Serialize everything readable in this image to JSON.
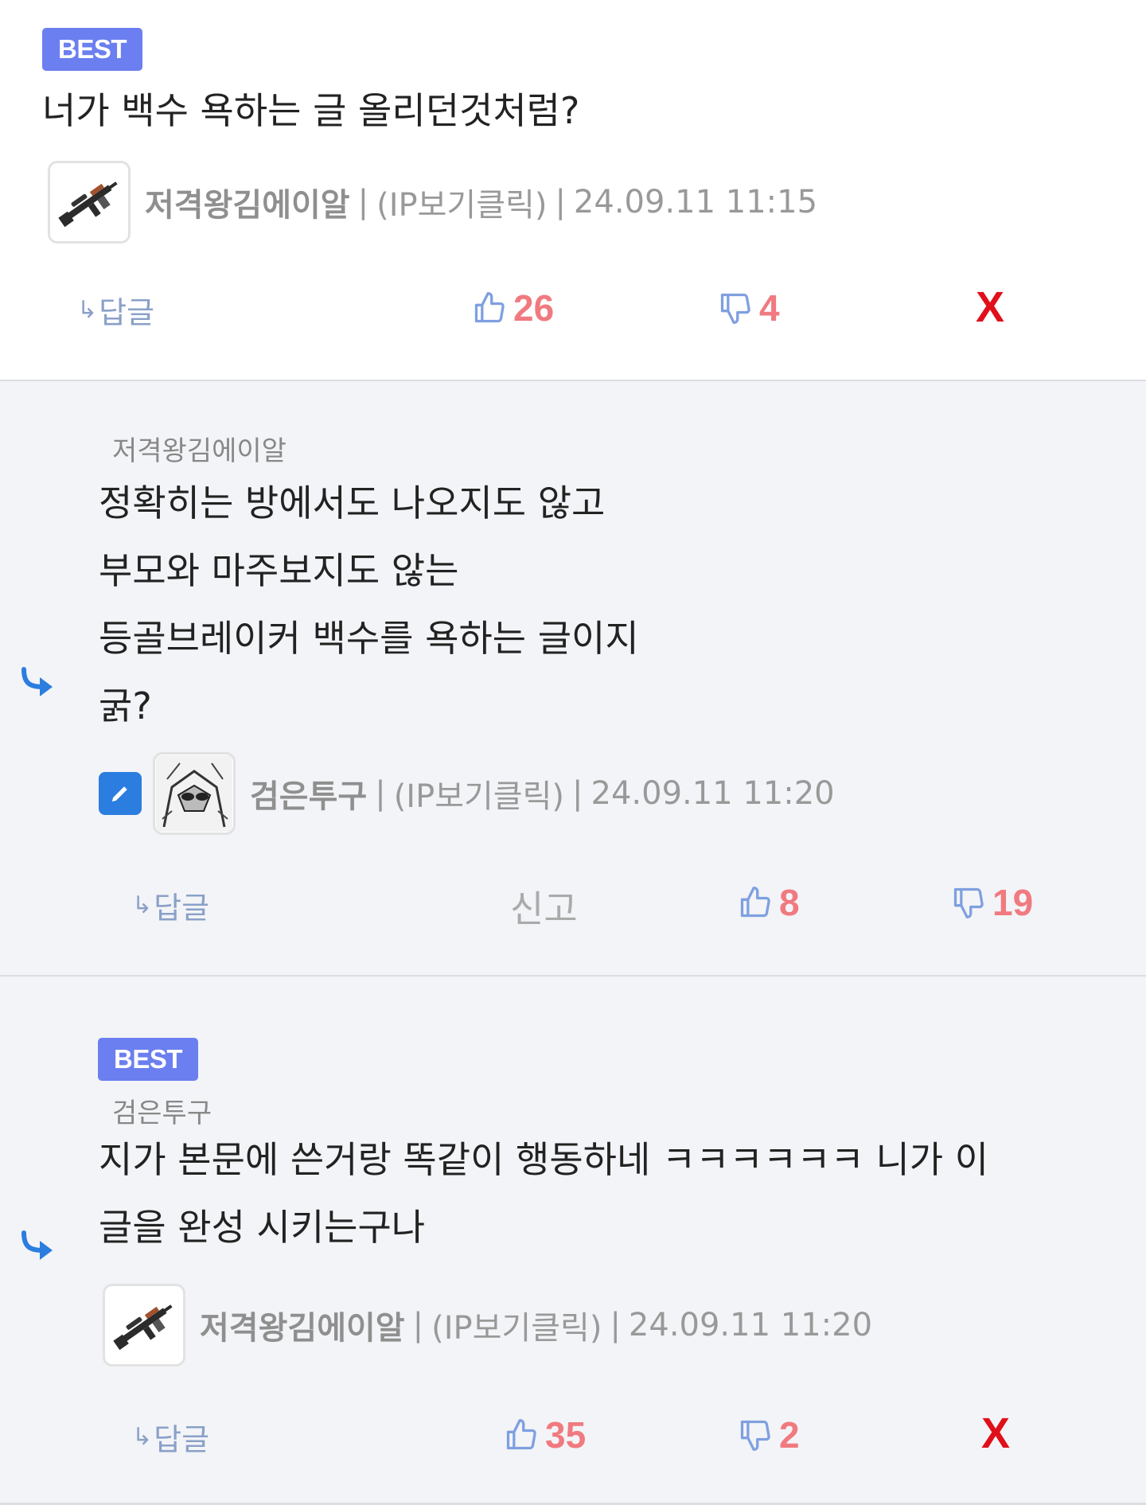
{
  "comments": [
    {
      "badge": "BEST",
      "text_lines": [
        "너가 백수 욕하는 글 올리던것처럼?"
      ],
      "nickname": "저격왕김에이알",
      "ip": "(IP보기클릭)",
      "date": "24.09.11 11:15",
      "reply_label": "답글",
      "likes": "26",
      "dislikes": "4",
      "delete_label": "X"
    },
    {
      "reply_to": "저격왕김에이알",
      "text_lines": [
        "정확히는 방에서도 나오지도 않고",
        "부모와 마주보지도 않는",
        "등골브레이커 백수를 욕하는 글이지",
        "굵?"
      ],
      "nickname": "검은투구",
      "ip": "(IP보기클릭)",
      "date": "24.09.11 11:20",
      "reply_label": "답글",
      "report_label": "신고",
      "likes": "8",
      "dislikes": "19"
    },
    {
      "badge": "BEST",
      "reply_to": "검은투구",
      "text_lines": [
        "지가 본문에 쓴거랑 똑같이 행동하네 ㅋㅋㅋㅋㅋㅋ 니가 이",
        "글을 완성 시키는구나"
      ],
      "nickname": "저격왕김에이알",
      "ip": "(IP보기클릭)",
      "date": "24.09.11 11:20",
      "reply_label": "답글",
      "likes": "35",
      "dislikes": "2",
      "delete_label": "X"
    }
  ],
  "separator": "|",
  "icons": {
    "reply_arrow": "reply-arrow-icon",
    "thumb_up": "thumbs-up-icon",
    "thumb_down": "thumbs-down-icon",
    "nested_reply": "nested-reply-arrow-icon",
    "edit": "pencil-icon",
    "avatar_rifle": "rifle-avatar",
    "avatar_drawing": "sketch-avatar"
  },
  "colors": {
    "badge": "#6b7ff0",
    "count": "#f07a80",
    "delete": "#e0101a",
    "thumb": "#7fa0e0",
    "blue_arrow": "#2b7de0"
  }
}
